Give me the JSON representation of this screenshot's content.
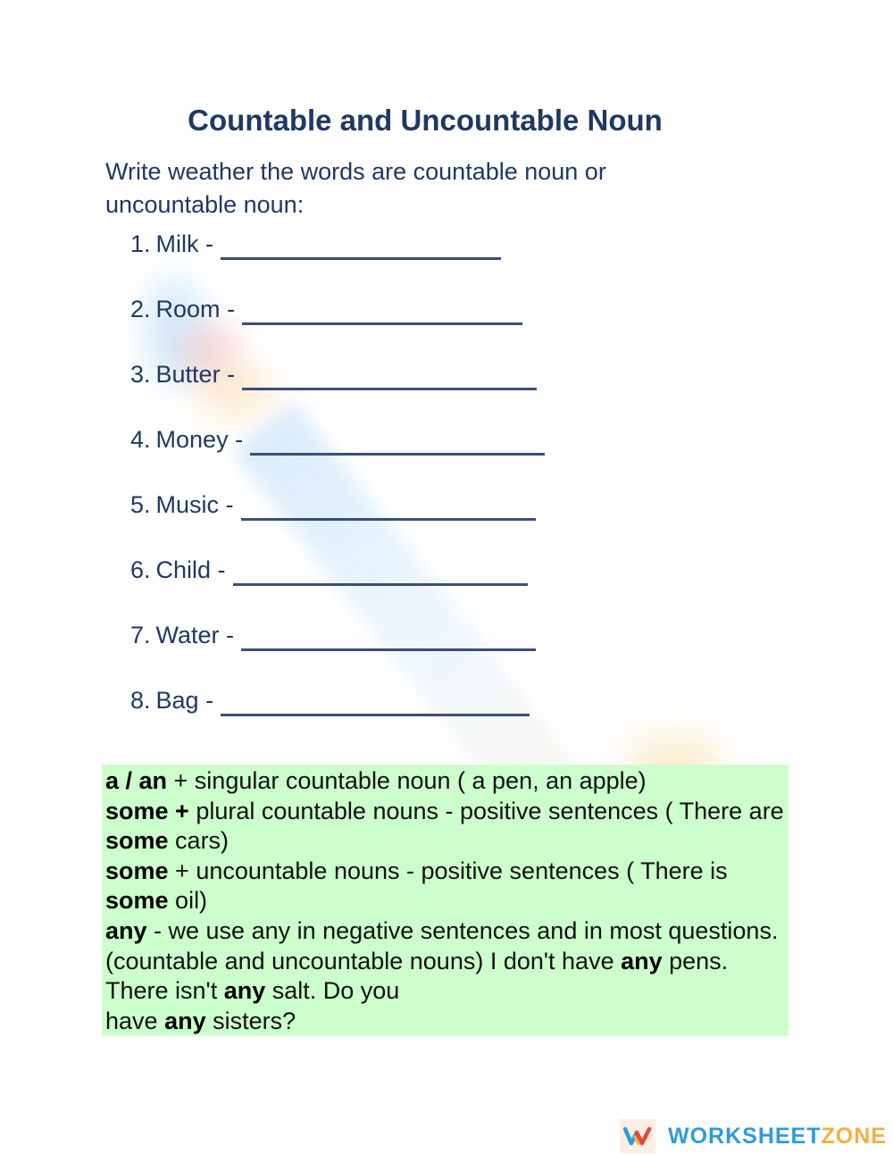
{
  "worksheet": {
    "title": "Countable and Uncountable Noun",
    "instructions": "Write weather the words are countable noun or uncountable noun:",
    "questions": [
      {
        "number": "1.",
        "word": "Milk -",
        "answer": ""
      },
      {
        "number": "2.",
        "word": "Room -",
        "answer": ""
      },
      {
        "number": "3.",
        "word": "Butter -",
        "answer": ""
      },
      {
        "number": "4.",
        "word": "Money -",
        "answer": ""
      },
      {
        "number": "5.",
        "word": "Music -",
        "answer": ""
      },
      {
        "number": "6.",
        "word": "Child -",
        "answer": ""
      },
      {
        "number": "7.",
        "word": "Water -",
        "answer": ""
      },
      {
        "number": "8.",
        "word": "Bag -",
        "answer": ""
      }
    ]
  },
  "rules": {
    "background_color": "#ccffcc",
    "r1": {
      "bold": "a / an",
      "text": " + singular countable noun ( a pen, an apple)"
    },
    "r2": {
      "bold": "some +",
      "text": " plural countable nouns - positive sentences ( There are ",
      "bold2": "some",
      "text2": " cars)"
    },
    "r3": {
      "bold": "some",
      "text": " +  uncountable nouns - positive sentences  ( There is ",
      "bold2": "some",
      "text2": " oil)"
    },
    "r4": {
      "bold": "any",
      "text": " - we use any in negative sentences and in most questions.(countable and uncountable nouns)  I don't have ",
      "bold2": "any",
      "text2": " pens. There isn't ",
      "bold3": "any",
      "text3": " salt. Do you",
      "text4": "have ",
      "bold4": "any",
      "text5": " sisters?"
    }
  },
  "brand": {
    "logo_letter": "W",
    "name_part1": "WORKSHEET",
    "name_part2": "ZONE",
    "colors": {
      "blue": "#2d9be0",
      "orange": "#f2b13e",
      "red": "#e8453c"
    }
  }
}
